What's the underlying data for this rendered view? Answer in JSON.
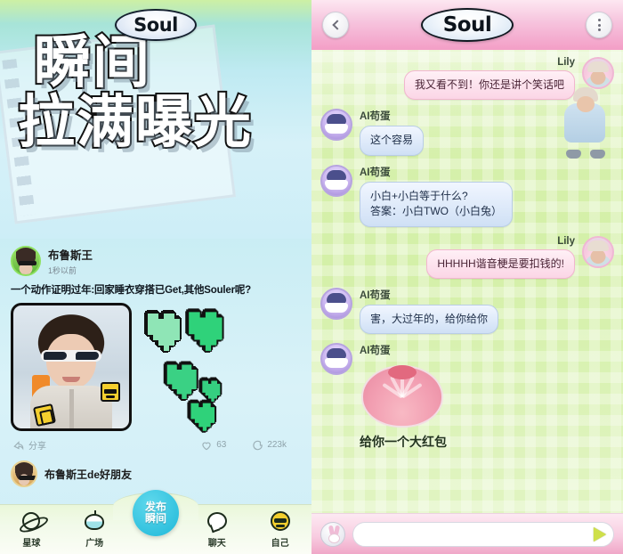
{
  "brand": {
    "name": "Soul"
  },
  "feed": {
    "hero": {
      "line1": "瞬间",
      "line2": "拉满曝光"
    },
    "post": {
      "author": "布鲁斯王",
      "time": "1秒以前",
      "text": "一个动作证明过年:回家睡衣穿搭已Get,其他Souler呢?",
      "share_label": "分享",
      "like_count": "63",
      "comment_count": "223k"
    },
    "next_post": {
      "author": "布鲁斯王de好朋友"
    },
    "tabs": [
      {
        "label": "星球",
        "icon": "planet-icon"
      },
      {
        "label": "广场",
        "icon": "square-icon"
      },
      {
        "label": "发布瞬间",
        "line1": "发布",
        "line2": "瞬间",
        "icon": "publish-icon"
      },
      {
        "label": "聊天",
        "icon": "chat-icon"
      },
      {
        "label": "自己",
        "icon": "profile-icon"
      }
    ]
  },
  "chat": {
    "header": {
      "back": "‹",
      "title": "Soul",
      "menu": "⋮"
    },
    "messages": [
      {
        "sender": "Lily",
        "side": "me",
        "text": "我又看不到！你还是讲个笑话吧",
        "avatar": "lily"
      },
      {
        "sender": "AI苟蛋",
        "side": "them",
        "text": "这个容易",
        "avatar": "ai"
      },
      {
        "sender": "AI苟蛋",
        "side": "them",
        "text": "小白+小白等于什么?\n答案：小白TWO（小白兔）",
        "avatar": "ai"
      },
      {
        "sender": "Lily",
        "side": "me",
        "text": "HHHHH谐音梗是要扣钱的!",
        "avatar": "lily"
      },
      {
        "sender": "AI苟蛋",
        "side": "them",
        "text": "害，大过年的，给你给你",
        "avatar": "ai"
      },
      {
        "sender": "AI苟蛋",
        "side": "them",
        "text": "给你一个大红包",
        "avatar": "ai",
        "type": "redpacket"
      }
    ],
    "input": {
      "value": "",
      "placeholder": "",
      "send_label": "send-icon",
      "emoji_label": "bunny-icon"
    }
  },
  "colors": {
    "accent_cyan": "#1fb8d9",
    "chat_bg_green": "#d4f0a8",
    "header_pink": "#f39ec6",
    "bubble_blue": "#cfe0f5",
    "bubble_pink": "#fbd6e6",
    "heart_green": "#2fd27a",
    "send_green": "#cfe04a"
  }
}
